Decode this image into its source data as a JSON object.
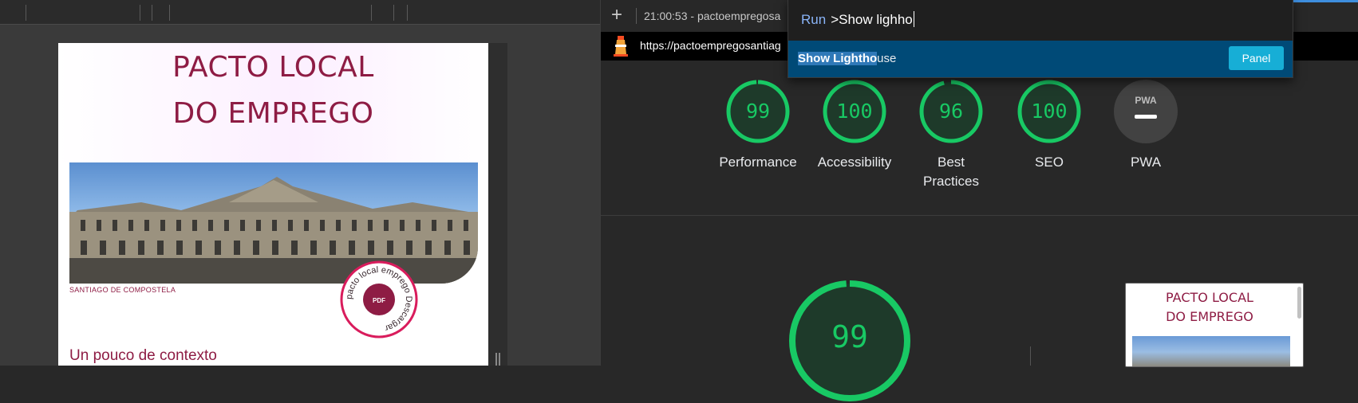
{
  "site": {
    "title_line1": "PACTO LOCAL",
    "title_line2": "DO EMPREGO",
    "caption": "SANTIAGO DE COMPOSTELA",
    "badge_ring_text": "pacto local emprego Descargar ",
    "badge_label": "PDF",
    "section_heading": "Un pouco de contexto",
    "brand_color": "#8e1c44"
  },
  "devtools": {
    "report_selector": "21:00:53 - pactoempregosa",
    "url": "https://pactoempregosantiag",
    "icons": {
      "new_report": "plus-icon",
      "logo": "lighthouse-icon"
    },
    "categories": [
      {
        "name": "Performance",
        "score": "99",
        "fraction": 0.99,
        "color": "#18c964"
      },
      {
        "name": "Accessibility",
        "score": "100",
        "fraction": 1.0,
        "color": "#18c964"
      },
      {
        "name": "Best Practices",
        "score": "96",
        "fraction": 0.96,
        "color": "#18c964"
      },
      {
        "name": "SEO",
        "score": "100",
        "fraction": 1.0,
        "color": "#18c964"
      },
      {
        "name": "PWA",
        "score": "",
        "fraction": 0,
        "color": "#9aa0a6"
      }
    ],
    "pwa_badge_text": "PWA",
    "main_score": "99",
    "main_fraction": 0.99,
    "thumbnail_title_line1": "PACTO LOCAL",
    "thumbnail_title_line2": "DO EMPREGO"
  },
  "command_menu": {
    "prompt": "Run",
    "query": ">Show lighho",
    "result_highlight_1": "Show Ligh",
    "result_highlight_2": "tho",
    "result_rest": "use",
    "result_badge": "Panel"
  }
}
